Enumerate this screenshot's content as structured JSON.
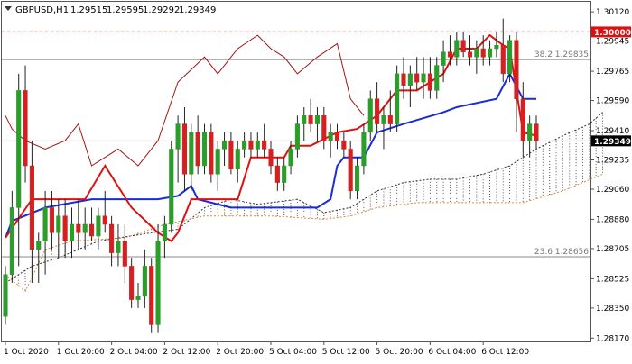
{
  "chart_data": {
    "type": "candlestick",
    "header": {
      "symbol_label": "GBPUSD,H1",
      "ohlc": [
        "1.29515",
        "1.29595",
        "1.29292",
        "1.29349"
      ]
    },
    "ylim": [
      1.2815,
      1.3018
    ],
    "y_ticks": [
      "1.28170",
      "1.28350",
      "1.28525",
      "1.28705",
      "1.28880",
      "1.29060",
      "1.29235",
      "1.29410",
      "1.29590",
      "1.29765",
      "1.29945",
      "1.30120"
    ],
    "x_ticks": [
      "1 Oct 2020",
      "1 Oct 20:00",
      "2 Oct 04:00",
      "2 Oct 12:00",
      "2 Oct 20:00",
      "5 Oct 04:00",
      "5 Oct 12:00",
      "5 Oct 20:00",
      "6 Oct 04:00",
      "6 Oct 12:00"
    ],
    "levels": [
      {
        "name": "round-level",
        "value": 1.3,
        "label": "1.30000",
        "color": "#cc0000",
        "style": "dashed"
      },
      {
        "name": "fib-382",
        "value": 1.29835,
        "label": "38.2 1.29835",
        "color": "#888888",
        "style": "solid"
      },
      {
        "name": "fib-236",
        "value": 1.28656,
        "label": "23.6 1.28656",
        "color": "#888888",
        "style": "solid"
      }
    ],
    "current_price": {
      "value": 1.29349,
      "label": "1.29349"
    },
    "colors": {
      "bull": "#2a9d2a",
      "bear": "#d42020",
      "tenkan": "#dd1111",
      "kijun": "#1a2bd8",
      "chikou": "#a01515",
      "span_a": "#333333",
      "span_b": "#d48a3a"
    },
    "candles": [
      [
        1.283,
        1.286,
        1.2825,
        1.2855
      ],
      [
        1.2855,
        1.2905,
        1.285,
        1.2895
      ],
      [
        1.2895,
        1.2975,
        1.286,
        1.2965
      ],
      [
        1.2965,
        1.298,
        1.291,
        1.292
      ],
      [
        1.292,
        1.2935,
        1.285,
        1.287
      ],
      [
        1.287,
        1.288,
        1.285,
        1.2875
      ],
      [
        1.2875,
        1.2905,
        1.2855,
        1.2895
      ],
      [
        1.2895,
        1.2905,
        1.287,
        1.288
      ],
      [
        1.288,
        1.29,
        1.2865,
        1.289
      ],
      [
        1.289,
        1.29,
        1.2865,
        1.2875
      ],
      [
        1.2875,
        1.2895,
        1.2865,
        1.2885
      ],
      [
        1.2885,
        1.29,
        1.287,
        1.288
      ],
      [
        1.288,
        1.2895,
        1.287,
        1.2885
      ],
      [
        1.2885,
        1.2895,
        1.2875,
        1.2878
      ],
      [
        1.2878,
        1.2895,
        1.287,
        1.289
      ],
      [
        1.289,
        1.2905,
        1.288,
        1.2885
      ],
      [
        1.2885,
        1.289,
        1.286,
        1.2868
      ],
      [
        1.2868,
        1.2885,
        1.286,
        1.2875
      ],
      [
        1.2875,
        1.2885,
        1.285,
        1.286
      ],
      [
        1.286,
        1.2865,
        1.2835,
        1.284
      ],
      [
        1.284,
        1.285,
        1.2835,
        1.2842
      ],
      [
        1.2842,
        1.287,
        1.2835,
        1.286
      ],
      [
        1.286,
        1.2865,
        1.282,
        1.2825
      ],
      [
        1.2825,
        1.2885,
        1.282,
        1.2875
      ],
      [
        1.2875,
        1.289,
        1.2865,
        1.2885
      ],
      [
        1.2885,
        1.2935,
        1.288,
        1.293
      ],
      [
        1.293,
        1.295,
        1.291,
        1.2945
      ],
      [
        1.2945,
        1.2955,
        1.2905,
        1.2915
      ],
      [
        1.2915,
        1.2945,
        1.2905,
        1.294
      ],
      [
        1.294,
        1.295,
        1.2915,
        1.292
      ],
      [
        1.292,
        1.2945,
        1.2915,
        1.294
      ],
      [
        1.294,
        1.2945,
        1.291,
        1.2915
      ],
      [
        1.2915,
        1.2935,
        1.2905,
        1.293
      ],
      [
        1.293,
        1.294,
        1.292,
        1.2935
      ],
      [
        1.2935,
        1.294,
        1.2915,
        1.2918
      ],
      [
        1.2918,
        1.2935,
        1.291,
        1.293
      ],
      [
        1.293,
        1.294,
        1.2925,
        1.2935
      ],
      [
        1.2935,
        1.294,
        1.2925,
        1.293
      ],
      [
        1.293,
        1.294,
        1.2925,
        1.2935
      ],
      [
        1.2935,
        1.2945,
        1.2925,
        1.293
      ],
      [
        1.293,
        1.2935,
        1.2915,
        1.292
      ],
      [
        1.292,
        1.2925,
        1.2905,
        1.291
      ],
      [
        1.291,
        1.2925,
        1.2905,
        1.292
      ],
      [
        1.292,
        1.2935,
        1.2915,
        1.293
      ],
      [
        1.293,
        1.295,
        1.2925,
        1.2945
      ],
      [
        1.2945,
        1.2955,
        1.2935,
        1.295
      ],
      [
        1.295,
        1.296,
        1.294,
        1.2945
      ],
      [
        1.2945,
        1.2955,
        1.2935,
        1.295
      ],
      [
        1.295,
        1.2955,
        1.293,
        1.2935
      ],
      [
        1.2935,
        1.2945,
        1.2925,
        1.294
      ],
      [
        1.294,
        1.2945,
        1.293,
        1.2935
      ],
      [
        1.2935,
        1.294,
        1.2925,
        1.293
      ],
      [
        1.293,
        1.2935,
        1.29,
        1.2905
      ],
      [
        1.2905,
        1.2925,
        1.29,
        1.292
      ],
      [
        1.292,
        1.2945,
        1.2915,
        1.294
      ],
      [
        1.294,
        1.2965,
        1.2935,
        1.296
      ],
      [
        1.296,
        1.297,
        1.294,
        1.2945
      ],
      [
        1.2945,
        1.2955,
        1.293,
        1.295
      ],
      [
        1.295,
        1.2965,
        1.294,
        1.2945
      ],
      [
        1.2945,
        1.298,
        1.294,
        1.2975
      ],
      [
        1.2975,
        1.2985,
        1.296,
        1.2968
      ],
      [
        1.2968,
        1.298,
        1.2955,
        1.2975
      ],
      [
        1.2975,
        1.2985,
        1.2965,
        1.297
      ],
      [
        1.297,
        1.2985,
        1.296,
        1.2975
      ],
      [
        1.2975,
        1.2985,
        1.296,
        1.2965
      ],
      [
        1.2965,
        1.2985,
        1.296,
        1.298
      ],
      [
        1.298,
        1.2995,
        1.297,
        1.2988
      ],
      [
        1.2988,
        1.2998,
        1.298,
        1.2985
      ],
      [
        1.2985,
        1.3,
        1.298,
        1.2995
      ],
      [
        1.2995,
        1.3,
        1.2985,
        1.2988
      ],
      [
        1.2988,
        1.2998,
        1.298,
        1.2985
      ],
      [
        1.2985,
        1.2995,
        1.2975,
        1.299
      ],
      [
        1.299,
        1.2998,
        1.298,
        1.2985
      ],
      [
        1.2985,
        1.2995,
        1.298,
        1.299
      ],
      [
        1.299,
        1.3,
        1.2985,
        1.2992
      ],
      [
        1.2992,
        1.3008,
        1.297,
        1.2975
      ],
      [
        1.2975,
        1.2998,
        1.297,
        1.2995
      ],
      [
        1.2995,
        1.3,
        1.294,
        1.296
      ],
      [
        1.296,
        1.297,
        1.2925,
        1.2935
      ],
      [
        1.2935,
        1.295,
        1.2925,
        1.2945
      ],
      [
        1.2945,
        1.295,
        1.293,
        1.2935
      ]
    ]
  },
  "indicators": {
    "tenkan": [
      [
        0,
        1.2877
      ],
      [
        4,
        1.29
      ],
      [
        12,
        1.29
      ],
      [
        15,
        1.292
      ],
      [
        19,
        1.2895
      ],
      [
        23,
        1.288
      ],
      [
        25,
        1.2875
      ],
      [
        26,
        1.288
      ],
      [
        28,
        1.29
      ],
      [
        35,
        1.29
      ],
      [
        37,
        1.2925
      ],
      [
        40,
        1.2925
      ],
      [
        42,
        1.2925
      ],
      [
        43,
        1.2932
      ],
      [
        46,
        1.2932
      ],
      [
        50,
        1.294
      ],
      [
        53,
        1.2942
      ],
      [
        56,
        1.295
      ],
      [
        59,
        1.2965
      ],
      [
        62,
        1.2965
      ],
      [
        66,
        1.2975
      ],
      [
        68,
        1.299
      ],
      [
        71,
        1.299
      ],
      [
        73,
        1.2998
      ],
      [
        74,
        1.2995
      ],
      [
        75,
        1.2992
      ],
      [
        76,
        1.299
      ],
      [
        77,
        1.2965
      ],
      [
        78,
        1.294
      ],
      [
        80,
        1.2938
      ]
    ],
    "kijun": [
      [
        0,
        1.2877
      ],
      [
        1,
        1.2887
      ],
      [
        6,
        1.2895
      ],
      [
        13,
        1.29
      ],
      [
        20,
        1.29
      ],
      [
        23,
        1.29
      ],
      [
        26,
        1.2902
      ],
      [
        28,
        1.2908
      ],
      [
        29,
        1.29
      ],
      [
        34,
        1.2895
      ],
      [
        40,
        1.2895
      ],
      [
        47,
        1.2895
      ],
      [
        49,
        1.29
      ],
      [
        50,
        1.292
      ],
      [
        51,
        1.2925
      ],
      [
        54,
        1.2925
      ],
      [
        56,
        1.294
      ],
      [
        60,
        1.2945
      ],
      [
        66,
        1.2952
      ],
      [
        68,
        1.2955
      ],
      [
        74,
        1.296
      ],
      [
        76,
        1.2975
      ],
      [
        78,
        1.296
      ],
      [
        80,
        1.296
      ]
    ],
    "chikou": [
      [
        0,
        1.295
      ],
      [
        1,
        1.2942
      ],
      [
        3,
        1.2935
      ],
      [
        6,
        1.293
      ],
      [
        9,
        1.2935
      ],
      [
        11,
        1.2945
      ],
      [
        13,
        1.292
      ],
      [
        17,
        1.293
      ],
      [
        20,
        1.292
      ],
      [
        23,
        1.2935
      ],
      [
        26,
        1.297
      ],
      [
        30,
        1.2985
      ],
      [
        32,
        1.2975
      ],
      [
        35,
        1.299
      ],
      [
        38,
        1.2998
      ],
      [
        40,
        1.299
      ],
      [
        42,
        1.2985
      ],
      [
        44,
        1.2975
      ],
      [
        47,
        1.2985
      ],
      [
        50,
        1.2993
      ],
      [
        52,
        1.296
      ],
      [
        54,
        1.295
      ]
    ],
    "span_a": [
      [
        0,
        1.285
      ],
      [
        4,
        1.286
      ],
      [
        8,
        1.2865
      ],
      [
        14,
        1.2875
      ],
      [
        22,
        1.288
      ],
      [
        26,
        1.2882
      ],
      [
        30,
        1.2895
      ],
      [
        34,
        1.29
      ],
      [
        38,
        1.2897
      ],
      [
        44,
        1.29
      ],
      [
        48,
        1.2892
      ],
      [
        52,
        1.2895
      ],
      [
        56,
        1.2905
      ],
      [
        60,
        1.291
      ],
      [
        64,
        1.2912
      ],
      [
        68,
        1.2912
      ],
      [
        72,
        1.2915
      ],
      [
        76,
        1.292
      ],
      [
        80,
        1.293
      ],
      [
        84,
        1.2938
      ],
      [
        88,
        1.2945
      ],
      [
        90,
        1.2952
      ]
    ],
    "span_b": [
      [
        0,
        1.2855
      ],
      [
        3,
        1.2845
      ],
      [
        6,
        1.287
      ],
      [
        10,
        1.2875
      ],
      [
        18,
        1.2877
      ],
      [
        24,
        1.2885
      ],
      [
        30,
        1.289
      ],
      [
        40,
        1.289
      ],
      [
        48,
        1.2888
      ],
      [
        52,
        1.289
      ],
      [
        56,
        1.2895
      ],
      [
        62,
        1.2898
      ],
      [
        70,
        1.2898
      ],
      [
        78,
        1.2898
      ],
      [
        84,
        1.2905
      ],
      [
        90,
        1.2915
      ]
    ]
  }
}
